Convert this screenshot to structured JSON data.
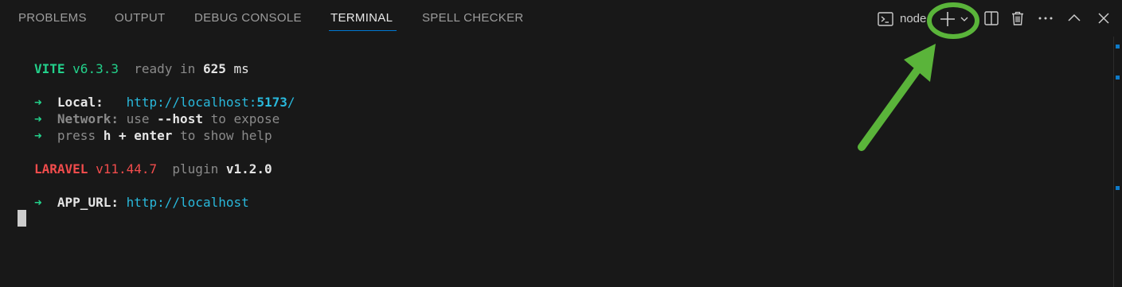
{
  "tabs": [
    {
      "label": "PROBLEMS",
      "active": false
    },
    {
      "label": "OUTPUT",
      "active": false
    },
    {
      "label": "DEBUG CONSOLE",
      "active": false
    },
    {
      "label": "TERMINAL",
      "active": true
    },
    {
      "label": "SPELL CHECKER",
      "active": false
    }
  ],
  "toolbar": {
    "terminal_name": "node",
    "icons": [
      "terminal-icon",
      "new-terminal-plus-icon",
      "chevron-down-icon",
      "split-terminal-icon",
      "trash-icon",
      "more-actions-icon",
      "maximize-panel-icon",
      "close-panel-icon"
    ]
  },
  "terminal": {
    "vite": {
      "name": "VITE",
      "version": "v6.3.3",
      "ready": "ready in",
      "time": "625",
      "unit": "ms"
    },
    "local": {
      "arrow": "➜",
      "label": "Local:",
      "url_prefix": "http://localhost:",
      "port": "5173",
      "url_suffix": "/"
    },
    "network": {
      "arrow": "➜",
      "label": "Network:",
      "text1": "use",
      "flag": "--host",
      "text2": "to expose"
    },
    "help": {
      "arrow": "➜",
      "text1": "press",
      "key": "h + enter",
      "text2": "to show help"
    },
    "laravel": {
      "name": "LARAVEL",
      "version": "v11.44.7",
      "plugin": "plugin",
      "plugin_version": "v1.2.0"
    },
    "app_url": {
      "arrow": "➜",
      "label": "APP_URL:",
      "url": "http://localhost"
    }
  },
  "colors": {
    "background": "#181818",
    "annotation": "#5ab43a",
    "accent": "#0078d4"
  }
}
